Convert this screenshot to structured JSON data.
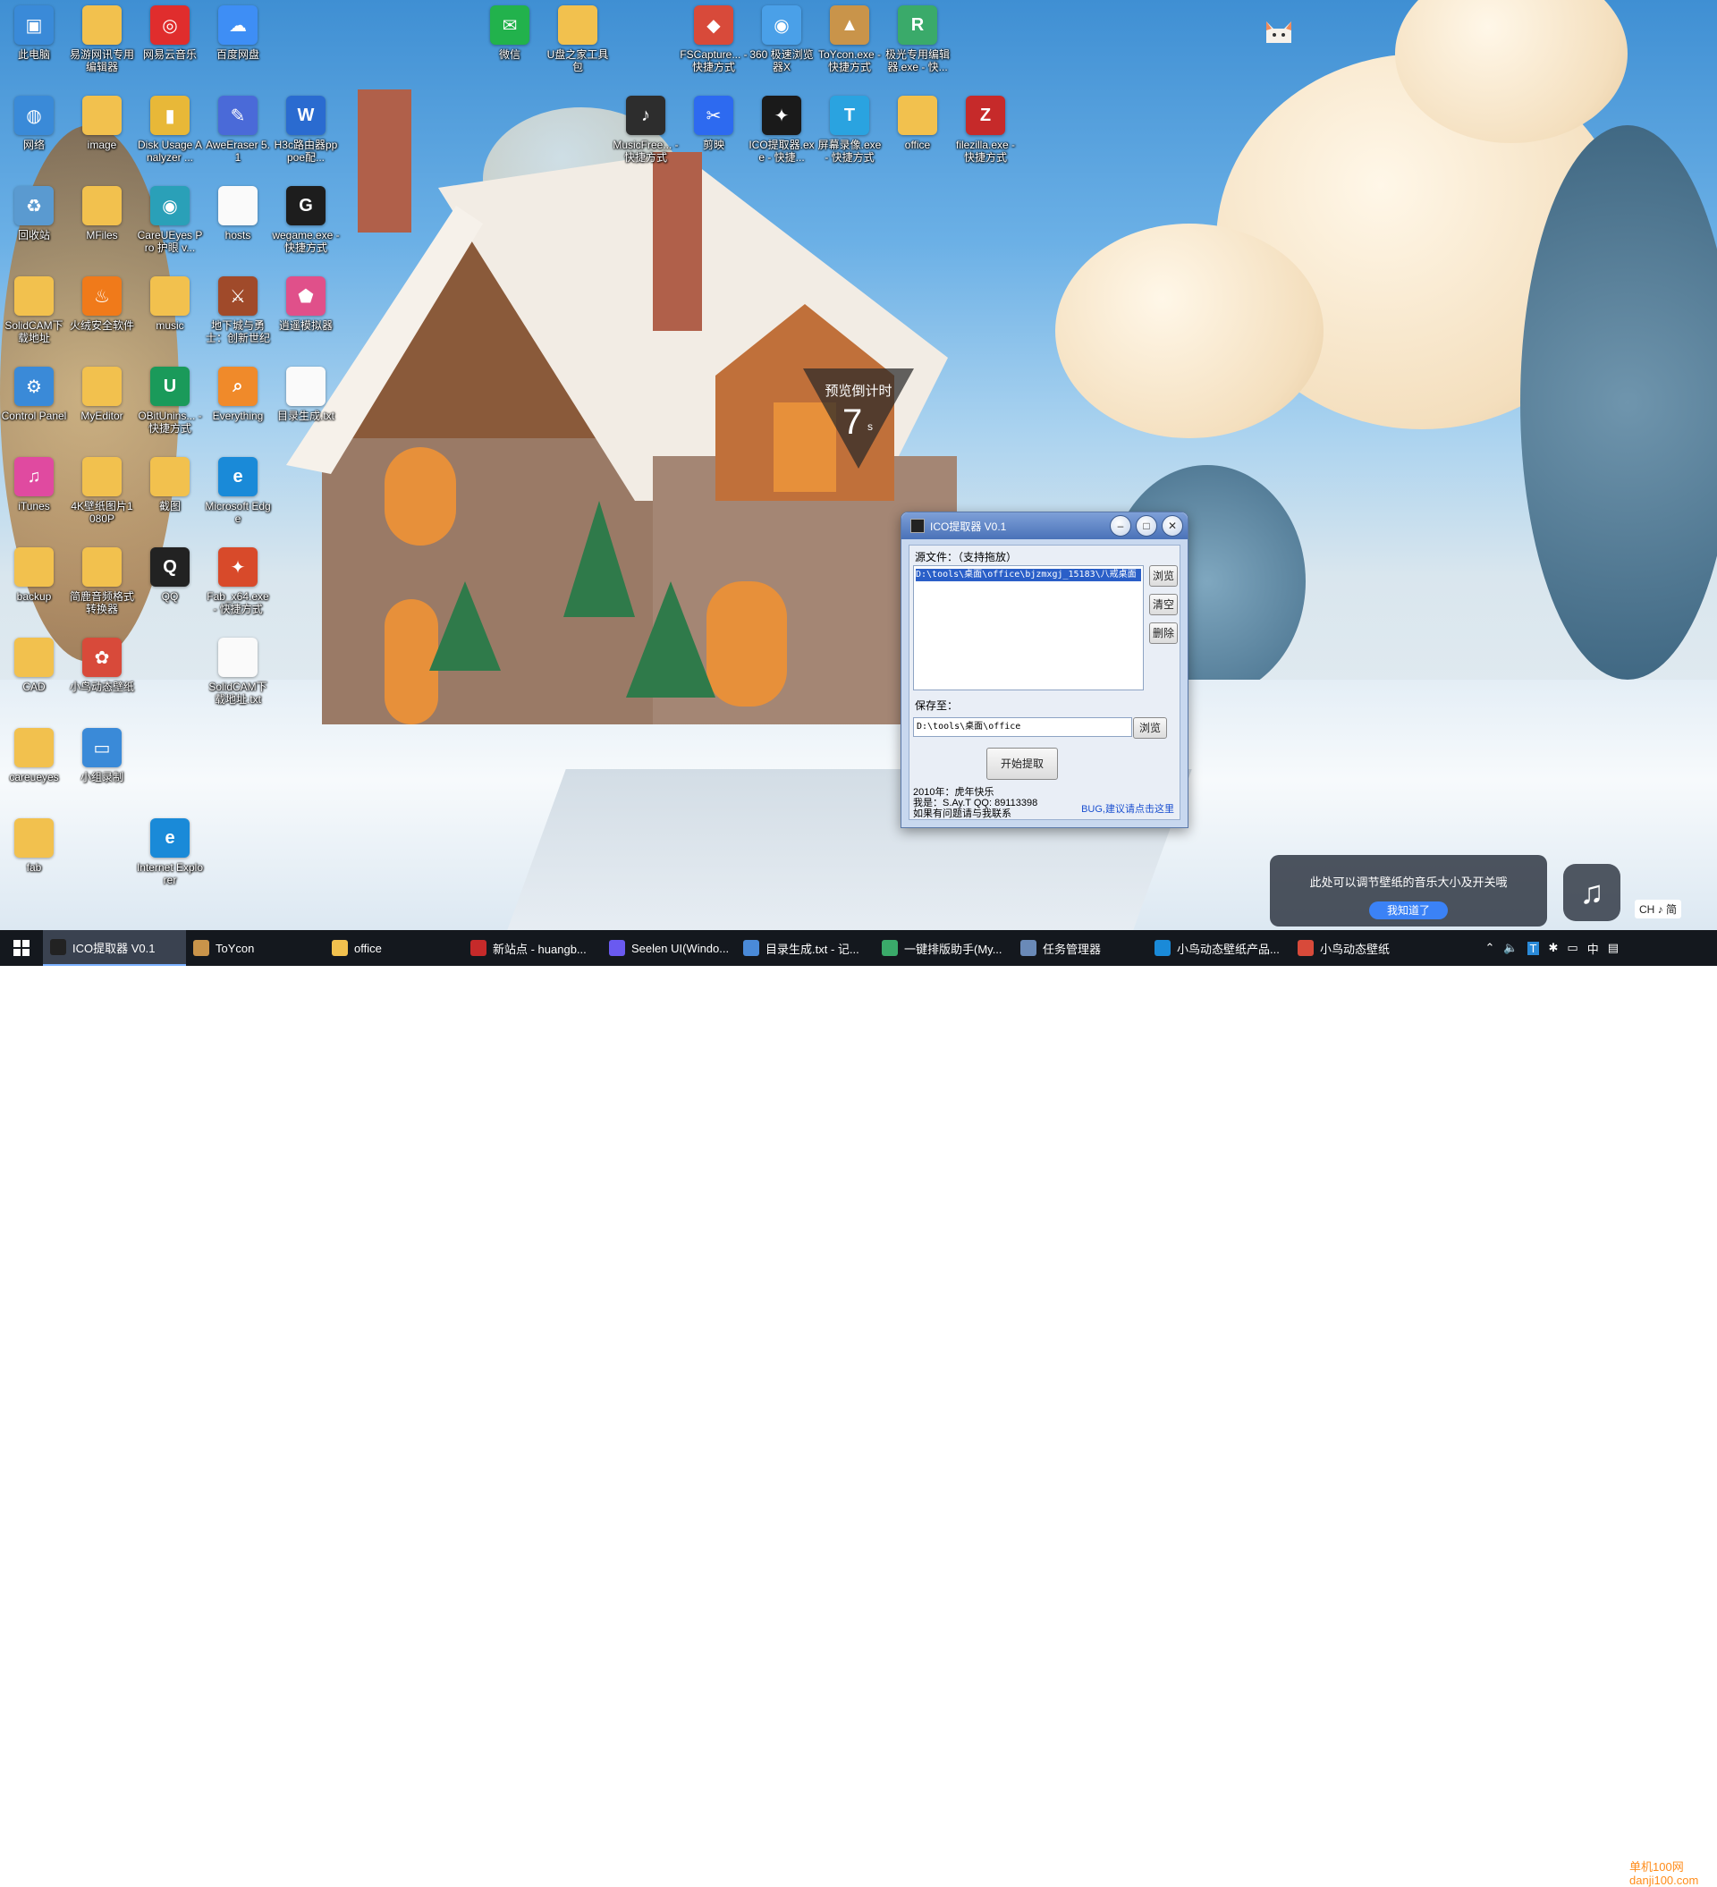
{
  "desktop": {
    "icons": [
      {
        "label": "此电脑",
        "color": "#3a8ad8",
        "glyph": "▣"
      },
      {
        "label": "易游网讯专用编辑器",
        "color": "#f2c14e",
        "glyph": ""
      },
      {
        "label": "网易云音乐",
        "color": "#e02d2d",
        "glyph": "◎"
      },
      {
        "label": "百度网盘",
        "color": "#3e8ef5",
        "glyph": "☁"
      },
      {
        "label": "微信",
        "color": "#22b24c",
        "glyph": "✉"
      },
      {
        "label": "U盘之家工具包",
        "color": "#f2c14e",
        "glyph": ""
      },
      {
        "label": "FSCapture... - 快捷方式",
        "color": "#d84a3a",
        "glyph": "◆"
      },
      {
        "label": "360 极速浏览器X",
        "color": "#4aa0e8",
        "glyph": "◉"
      },
      {
        "label": "ToYcon.exe - 快捷方式",
        "color": "#c9944a",
        "glyph": "▲"
      },
      {
        "label": "极光专用编辑器.exe - 快...",
        "color": "#3aaa6a",
        "glyph": "R"
      },
      {
        "label": "网络",
        "color": "#3a8ad8",
        "glyph": "◍"
      },
      {
        "label": "image",
        "color": "#f2c14e",
        "glyph": ""
      },
      {
        "label": "Disk Usage Analyzer ...",
        "color": "#e8b838",
        "glyph": "▮"
      },
      {
        "label": "AweEraser 5.1",
        "color": "#4a6ad8",
        "glyph": "✎"
      },
      {
        "label": "H3c路由器pppoe配...",
        "color": "#2a6bd0",
        "glyph": "W"
      },
      {
        "label": "MusicFree... - 快捷方式",
        "color": "#2d2d2d",
        "glyph": "♪"
      },
      {
        "label": "剪映",
        "color": "#2d6af0",
        "glyph": "✂"
      },
      {
        "label": "ICO提取器.exe - 快捷...",
        "color": "#1a1a1a",
        "glyph": "✦"
      },
      {
        "label": "屏幕录像.exe - 快捷方式",
        "color": "#2aa3e0",
        "glyph": "T"
      },
      {
        "label": "office",
        "color": "#f2c14e",
        "glyph": ""
      },
      {
        "label": "filezilla.exe - 快捷方式",
        "color": "#c62a2a",
        "glyph": "Z"
      },
      {
        "label": "回收站",
        "color": "#5a9ad0",
        "glyph": "♻"
      },
      {
        "label": "MFiles",
        "color": "#f2c14e",
        "glyph": ""
      },
      {
        "label": "CareUEyes Pro 护眼 v...",
        "color": "#2aa0b8",
        "glyph": "◉"
      },
      {
        "label": "hosts",
        "color": "#fafafa",
        "glyph": ""
      },
      {
        "label": "wegame.exe - 快捷方式",
        "color": "#1d1d1d",
        "glyph": "G"
      },
      {
        "label": "SolidCAM下载地址",
        "color": "#f2c14e",
        "glyph": ""
      },
      {
        "label": "火绒安全软件",
        "color": "#f07a1a",
        "glyph": "♨"
      },
      {
        "label": "music",
        "color": "#f2c14e",
        "glyph": ""
      },
      {
        "label": "地下城与勇士：创新世纪",
        "color": "#a04a2a",
        "glyph": "⚔"
      },
      {
        "label": "逍遥模拟器",
        "color": "#e0508a",
        "glyph": "⬟"
      },
      {
        "label": "Control Panel",
        "color": "#3a8ad8",
        "glyph": "⚙"
      },
      {
        "label": "MyEditor",
        "color": "#f2c14e",
        "glyph": ""
      },
      {
        "label": "OBitUnins... - 快捷方式",
        "color": "#1a9a5a",
        "glyph": "U"
      },
      {
        "label": "Everything",
        "color": "#f08a2a",
        "glyph": "⌕"
      },
      {
        "label": "目录生成.txt",
        "color": "#fafafa",
        "glyph": ""
      },
      {
        "label": "iTunes",
        "color": "#e04aa0",
        "glyph": "♫"
      },
      {
        "label": "4K壁纸图片1080P",
        "color": "#f2c14e",
        "glyph": ""
      },
      {
        "label": "截图",
        "color": "#f2c14e",
        "glyph": ""
      },
      {
        "label": "Microsoft Edge",
        "color": "#1a8ad8",
        "glyph": "e"
      },
      {
        "label": "backup",
        "color": "#f2c14e",
        "glyph": ""
      },
      {
        "label": "简鹿音频格式转换器",
        "color": "#f2c14e",
        "glyph": ""
      },
      {
        "label": "QQ",
        "color": "#222",
        "glyph": "Q"
      },
      {
        "label": "Fab_x64.exe - 快捷方式",
        "color": "#d84a2a",
        "glyph": "✦"
      },
      {
        "label": "CAD",
        "color": "#f2c14e",
        "glyph": ""
      },
      {
        "label": "小鸟动态壁纸",
        "color": "#d84a3a",
        "glyph": "✿"
      },
      {
        "label": "SolidCAM下载地址.txt",
        "color": "#fafafa",
        "glyph": ""
      },
      {
        "label": "careueyes",
        "color": "#f2c14e",
        "glyph": ""
      },
      {
        "label": "小组录制",
        "color": "#3a8ad8",
        "glyph": "▭"
      },
      {
        "label": "fab",
        "color": "#f2c14e",
        "glyph": ""
      },
      {
        "label": "Internet Explorer",
        "color": "#1a8ad8",
        "glyph": "e"
      }
    ]
  },
  "countdown": {
    "title": "预览倒计时",
    "value": "7",
    "unit": "s"
  },
  "ico_window": {
    "title": "ICO提取器 V0.1",
    "source_label": "源文件：（支持拖放）",
    "source_value": "D:\\tools\\桌面\\office\\bjzmxgj_15183\\八戒桌面",
    "browse1": "浏览",
    "clear": "清空",
    "delete": "删除",
    "save_label": "保存至：",
    "save_value": "D:\\tools\\桌面\\office",
    "browse2": "浏览",
    "start": "开始提取",
    "info1": "2010年：虎年快乐",
    "info2": "我是：S.Ay.T  QQ: 89113398",
    "info3": "如果有问题请与我联系",
    "link": "BUG,建议请点击这里"
  },
  "tooltip": {
    "text": "此处可以调节壁纸的音乐大小及开关哦",
    "button": "我知道了"
  },
  "ime_label": "CH ♪ 简",
  "taskbar": {
    "tasks": [
      {
        "label": "ICO提取器 V0.1",
        "color": "#222",
        "active": true
      },
      {
        "label": "ToYcon",
        "color": "#c9944a",
        "active": false
      },
      {
        "label": "office",
        "color": "#f2c14e",
        "active": false
      },
      {
        "label": "新站点 - huangb...",
        "color": "#c62a2a",
        "active": false
      },
      {
        "label": "Seelen UI(Windo...",
        "color": "#6a5af0",
        "active": false
      },
      {
        "label": "目录生成.txt - 记...",
        "color": "#4a8ad8",
        "active": false
      },
      {
        "label": "一键排版助手(My...",
        "color": "#3aaa6a",
        "active": false
      },
      {
        "label": "任务管理器",
        "color": "#6a8ab8",
        "active": false
      },
      {
        "label": "小鸟动态壁纸产品...",
        "color": "#1a8ad8",
        "active": false
      },
      {
        "label": "小鸟动态壁纸",
        "color": "#d84a3a",
        "active": false
      }
    ],
    "tray_lang": "中",
    "watermark_top": "单机100网",
    "watermark_bottom": "danji100.com"
  },
  "colors": {
    "taskbar_bg": "#14181e",
    "window_title": "#4a72b8",
    "accent": "#3b82f6"
  }
}
